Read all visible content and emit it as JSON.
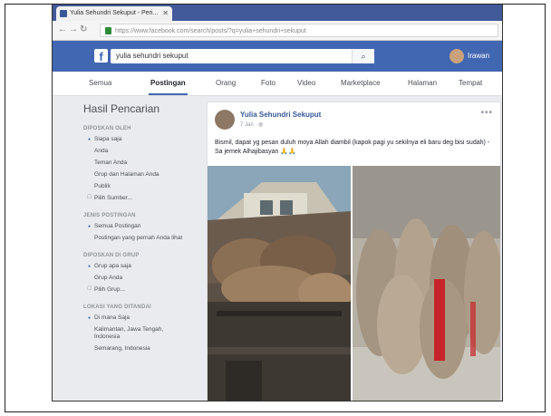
{
  "browser": {
    "tab_title": "Yulia Sehundri Sekuput - Peri...",
    "tab_close": "✕",
    "address": "https://www.facebook.com/search/posts/?q=yulia+sehundri+sekuput"
  },
  "fb": {
    "logo": "f",
    "search_value": "yulia sehundri sekuput",
    "search_icon": "search-icon",
    "user_name": "Irawan"
  },
  "filters": [
    "Semua",
    "Postingan",
    "Orang",
    "Foto",
    "Video",
    "Marketplace",
    "Halaman",
    "Tempat"
  ],
  "sidebar": {
    "title": "Hasil Pencarian",
    "groups": [
      {
        "heading": "DIPOSKAN OLEH",
        "items": [
          {
            "label": "Siapa saja",
            "state": "sel"
          },
          {
            "label": "Anda",
            "state": ""
          },
          {
            "label": "Teman Anda",
            "state": ""
          },
          {
            "label": "Grup dan Halaman Anda",
            "state": ""
          },
          {
            "label": "Publik",
            "state": ""
          },
          {
            "label": "Pilih Sumber...",
            "state": "chk"
          }
        ]
      },
      {
        "heading": "JENIS POSTINGAN",
        "items": [
          {
            "label": "Semua Postingan",
            "state": "sel"
          },
          {
            "label": "Postingan yang pernah Anda lihat",
            "state": ""
          }
        ]
      },
      {
        "heading": "DIPOSKAN DI GRUP",
        "items": [
          {
            "label": "Grup apa saja",
            "state": "sel"
          },
          {
            "label": "Grup Anda",
            "state": ""
          },
          {
            "label": "Pilih Grup...",
            "state": "chk"
          }
        ]
      },
      {
        "heading": "LOKASI YANG DITANDAI",
        "items": [
          {
            "label": "Di mana Saja",
            "state": "sel"
          },
          {
            "label": "Kalimantan, Jawa Tengah, Indonesia",
            "state": ""
          },
          {
            "label": "Semarang, Indonesia",
            "state": ""
          }
        ]
      }
    ]
  },
  "post": {
    "author": "Yulia Sehundri Sekuput",
    "time": "7 Jan",
    "privacy_icon": "globe-icon",
    "more": "•••",
    "text": "Bismil, dapat yg pesan duluh moya Allah diambil (kapok pagi yu sekilnya eli baru deg bisi sudah) - Sa jemek Alhajibasyan 🙏🙏"
  }
}
